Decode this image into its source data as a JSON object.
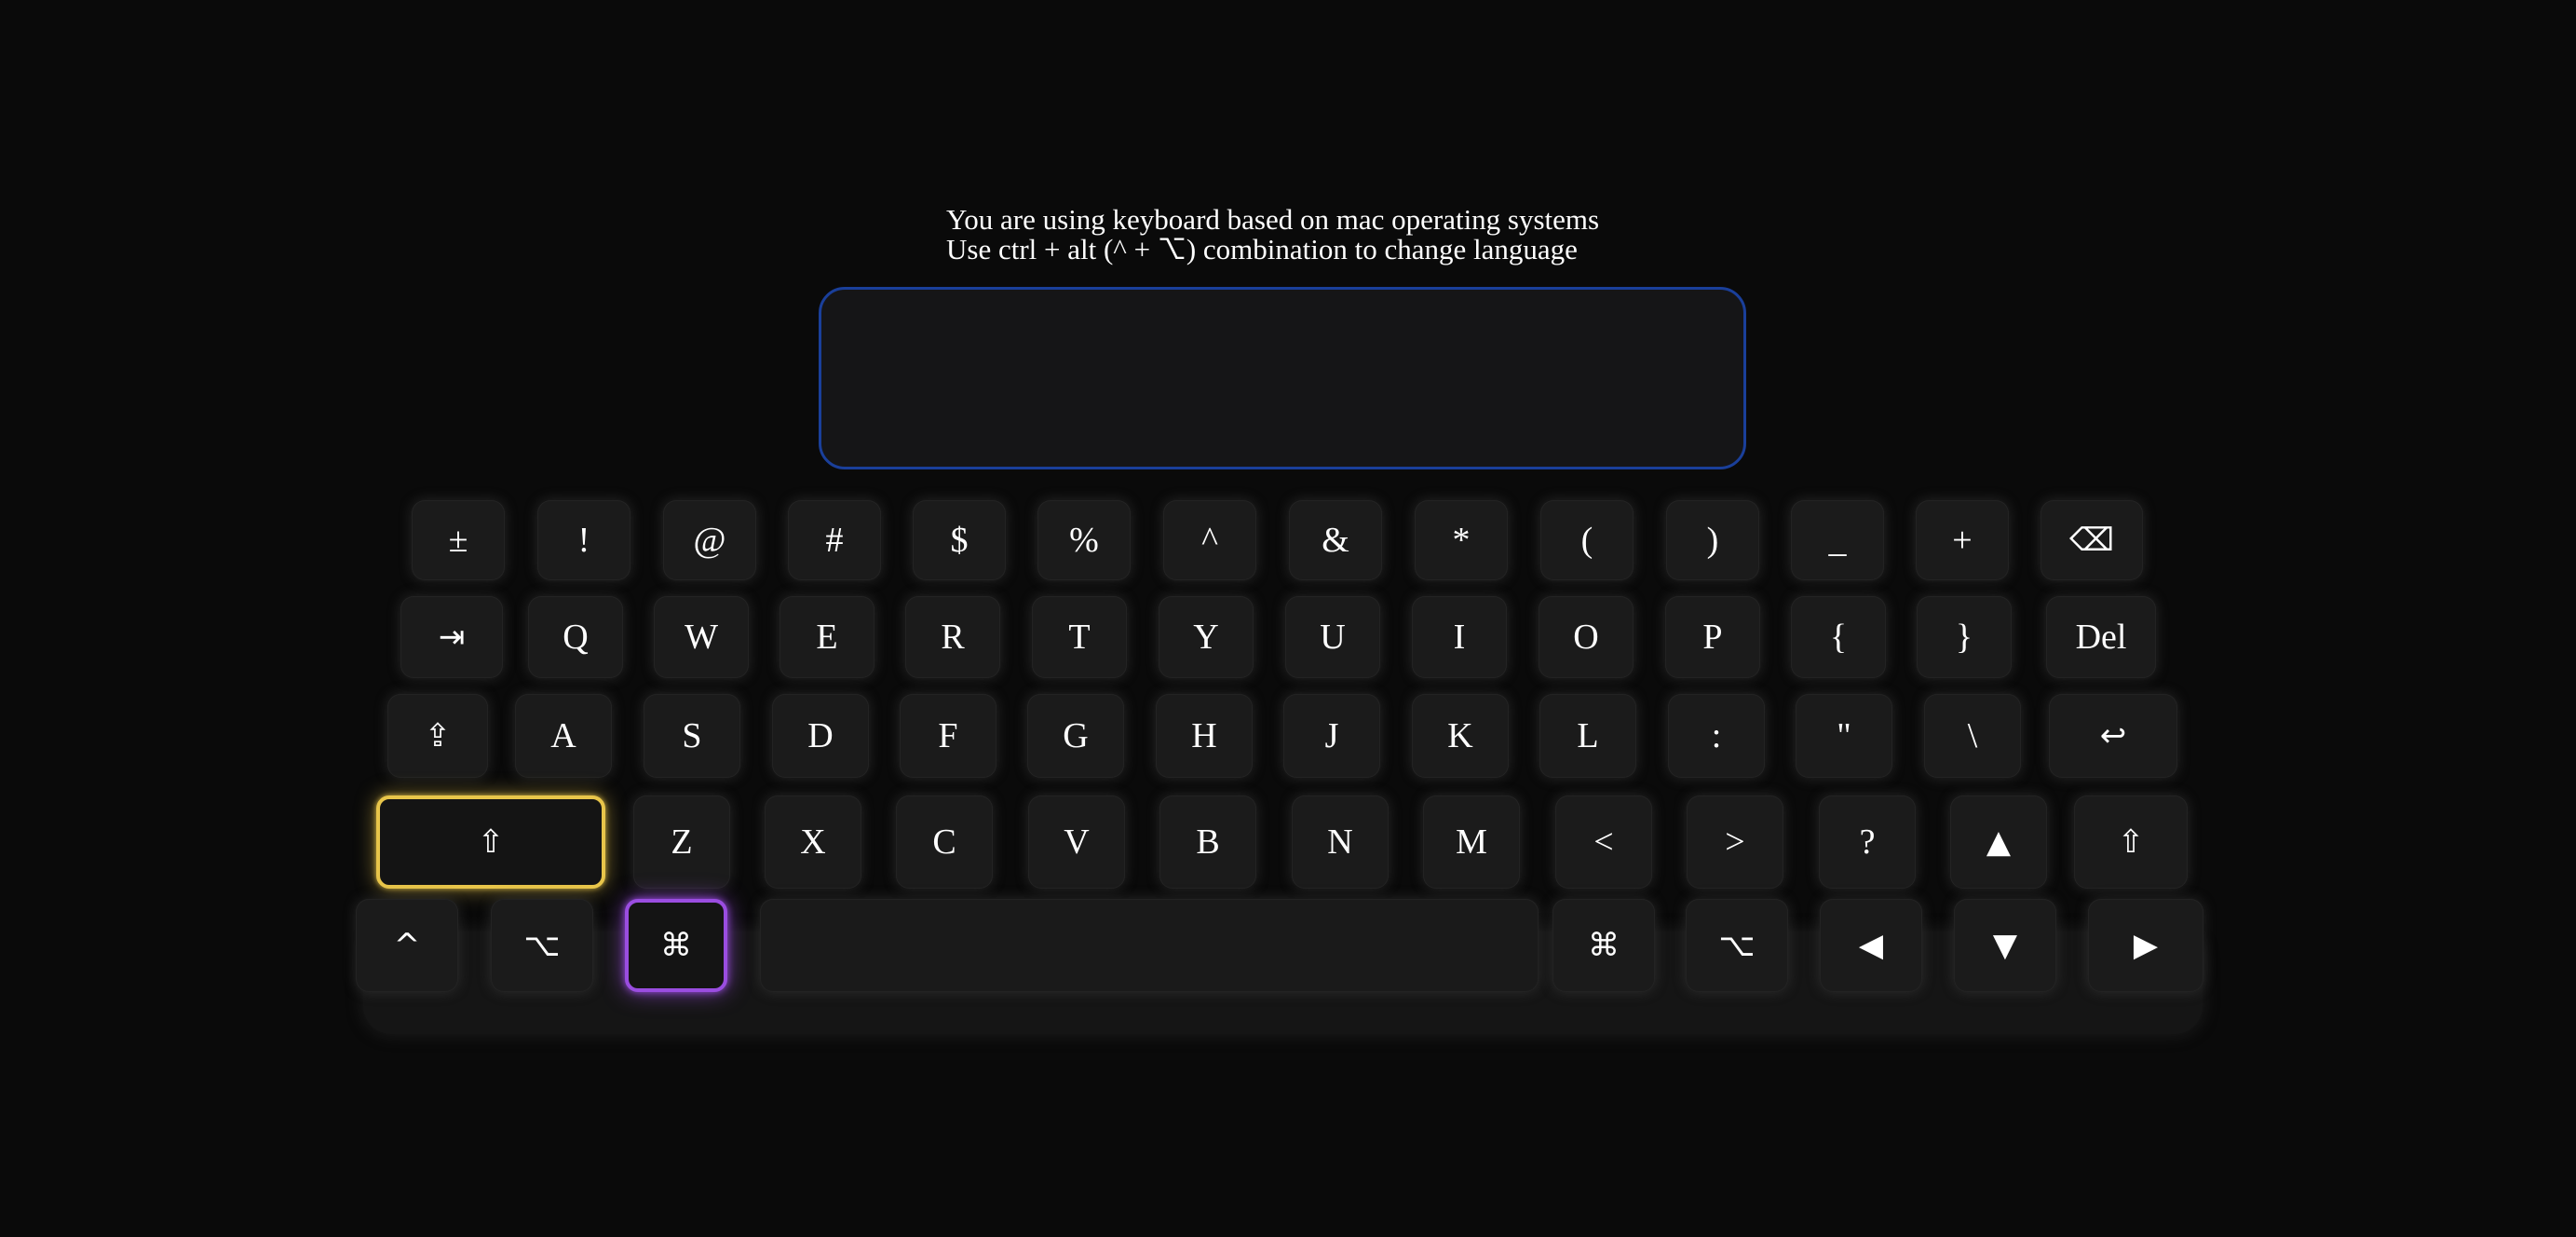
{
  "instructions": {
    "line1": "You are using keyboard based on mac operating systems",
    "line2": "Use ctrl + alt (^ + ⌥) combination to change language"
  },
  "textbox": {
    "value": "",
    "placeholder": ""
  },
  "colors": {
    "background": "#0a0a0a",
    "key": "#1b1b1b",
    "textbox_border": "#1a3f9a",
    "shift_highlight": "#e8c54a",
    "cmd_highlight": "#9a4de0"
  },
  "keyboard": {
    "row1": [
      "±",
      "!",
      "@",
      "#",
      "$",
      "%",
      "^",
      "&",
      "*",
      "(",
      ")",
      "_",
      "+",
      "⌫"
    ],
    "row2": [
      "⇥",
      "Q",
      "W",
      "E",
      "R",
      "T",
      "Y",
      "U",
      "I",
      "O",
      "P",
      "{",
      "}",
      "Del"
    ],
    "row3": [
      "⇪",
      "A",
      "S",
      "D",
      "F",
      "G",
      "H",
      "J",
      "K",
      "L",
      ":",
      "\"",
      "\\",
      "↩"
    ],
    "row4": [
      "⇧",
      "Z",
      "X",
      "C",
      "V",
      "B",
      "N",
      "M",
      "<",
      ">",
      "?",
      "▲",
      "⇧"
    ],
    "row5": [
      "^",
      "⌥",
      "⌘",
      "",
      "⌘",
      "⌥",
      "◀",
      "▼",
      "▶"
    ]
  },
  "active_keys": [
    "left-shift",
    "left-command"
  ]
}
